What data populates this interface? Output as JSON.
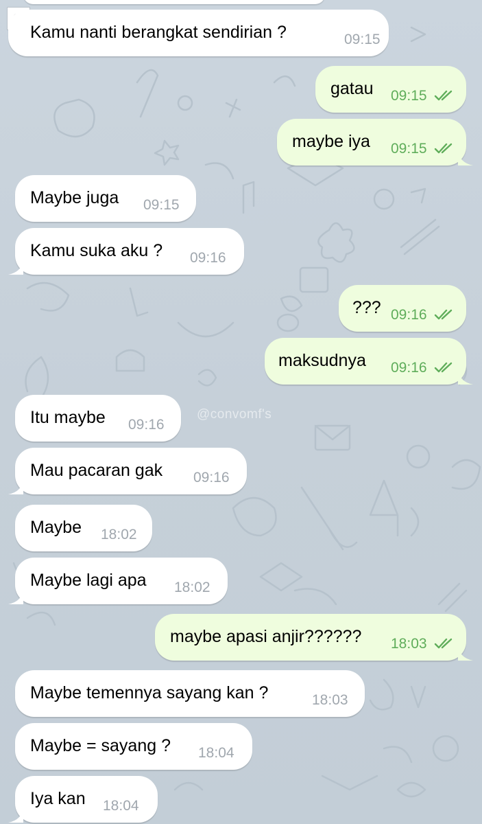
{
  "watermark": "@convomf's",
  "colors": {
    "incoming_bubble": "#ffffff",
    "outgoing_bubble": "#effdde",
    "outgoing_time": "#5fad5a",
    "incoming_time": "#a0a7ae",
    "wallpaper": "#c9d3dc"
  },
  "messages": [
    {
      "direction": "in",
      "text": "Kamu nanti berangkat sendirian ?",
      "time": "09:15"
    },
    {
      "direction": "out",
      "text": "gatau",
      "time": "09:15",
      "status": "read-double-check-icon"
    },
    {
      "direction": "out",
      "text": "maybe iya",
      "time": "09:15",
      "status": "read-double-check-icon"
    },
    {
      "direction": "in",
      "text": "Maybe juga",
      "time": "09:15"
    },
    {
      "direction": "in",
      "text": "Kamu suka aku ?",
      "time": "09:16"
    },
    {
      "direction": "out",
      "text": "???",
      "time": "09:16",
      "status": "read-double-check-icon"
    },
    {
      "direction": "out",
      "text": "maksudnya",
      "time": "09:16",
      "status": "read-double-check-icon"
    },
    {
      "direction": "in",
      "text": "Itu maybe",
      "time": "09:16"
    },
    {
      "direction": "in",
      "text": "Mau pacaran gak",
      "time": "09:16"
    },
    {
      "direction": "in",
      "text": "Maybe",
      "time": "18:02"
    },
    {
      "direction": "in",
      "text": "Maybe lagi apa",
      "time": "18:02"
    },
    {
      "direction": "out",
      "text": "maybe apasi anjir??????",
      "time": "18:03",
      "status": "read-double-check-icon"
    },
    {
      "direction": "in",
      "text": "Maybe temennya sayang kan ?",
      "time": "18:03"
    },
    {
      "direction": "in",
      "text": "Maybe = sayang ?",
      "time": "18:04"
    },
    {
      "direction": "in",
      "text": "Iya kan",
      "time": "18:04"
    }
  ]
}
